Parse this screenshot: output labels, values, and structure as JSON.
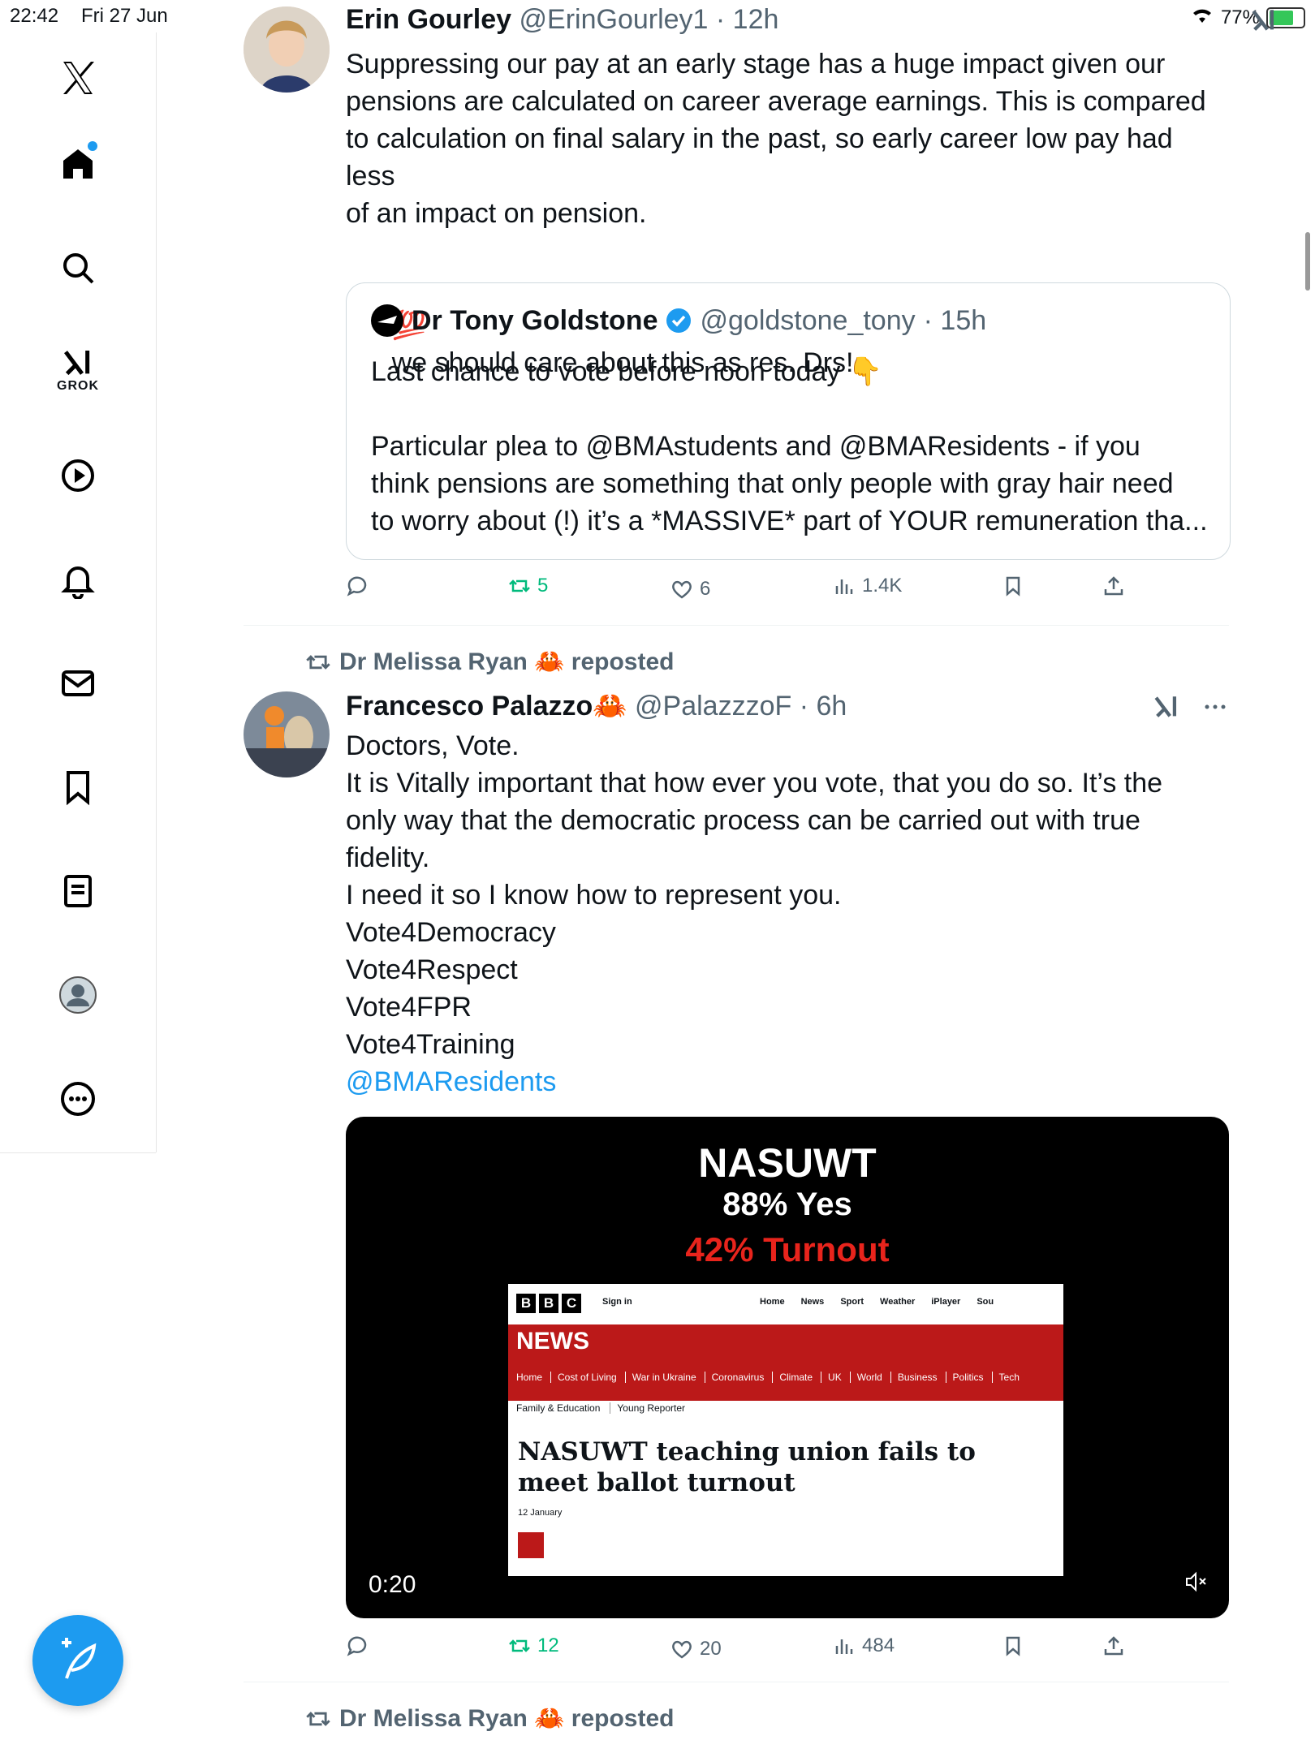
{
  "status_bar": {
    "time": "22:42",
    "date": "Fri 27 Jun",
    "battery": "77%",
    "battery_level": 0.77
  },
  "sidebar": {
    "grok_label": "GROK"
  },
  "tweet1": {
    "author_name": "Erin Gourley",
    "author_handle": "@ErinGourley1",
    "age": "· 12h",
    "text": "Suppressing our pay at an early stage has a huge impact given our\npensions are calculated on career average earnings. This is compared\nto calculation on final salary in the past, so early career low pay had less\nof an impact on pension.",
    "text2_emoji": "💯",
    "text2": "we should care about this as res. Drs!",
    "quote": {
      "author_name": "Dr Tony Goldstone",
      "author_handle": "@goldstone_tony",
      "age": "· 15h",
      "text1": "Last chance to vote before noon today 👇",
      "text2": "Particular plea to @BMAstudents and @BMAResidents - if you\nthink pensions are something that only people with gray hair need\nto worry about (!) it’s a *MASSIVE* part of YOUR remuneration tha..."
    },
    "stats": {
      "retweets": "5",
      "likes": "6",
      "views": "1.4K"
    }
  },
  "tweet2": {
    "reposted_by": "Dr Melissa Ryan 🦀 reposted",
    "author_name": "Francesco Palazzo🦀",
    "author_handle": "@PalazzzoF",
    "age": "· 6h",
    "lines": [
      "Doctors, Vote.",
      "It is Vitally important that how ever you vote, that you do so. It’s the",
      "only way that the democratic process can be carried out with true",
      "fidelity.",
      "I need it so I know how to represent you.",
      "Vote4Democracy",
      "Vote4Respect",
      "Vote4FPR",
      "Vote4Training"
    ],
    "mention": "@BMAResidents",
    "video": {
      "title": "NASUWT",
      "yes": "88% Yes",
      "turnout": "42% Turnout",
      "duration": "0:20",
      "bbc": {
        "sign_in": "Sign in",
        "nav": [
          "Home",
          "News",
          "Sport",
          "Weather",
          "iPlayer",
          "Sou"
        ],
        "news": "NEWS",
        "subnav": [
          "Home",
          "Cost of Living",
          "War in Ukraine",
          "Coronavirus",
          "Climate",
          "UK",
          "World",
          "Business",
          "Politics",
          "Tech"
        ],
        "subnav2": [
          "Family & Education",
          "Young Reporter"
        ],
        "headline": "NASUWT teaching union fails to meet ballot turnout",
        "date": "12 January"
      }
    },
    "stats": {
      "retweets": "12",
      "likes": "20",
      "views": "484"
    }
  },
  "tweet3": {
    "reposted_by": "Dr Melissa Ryan 🦀 reposted"
  }
}
